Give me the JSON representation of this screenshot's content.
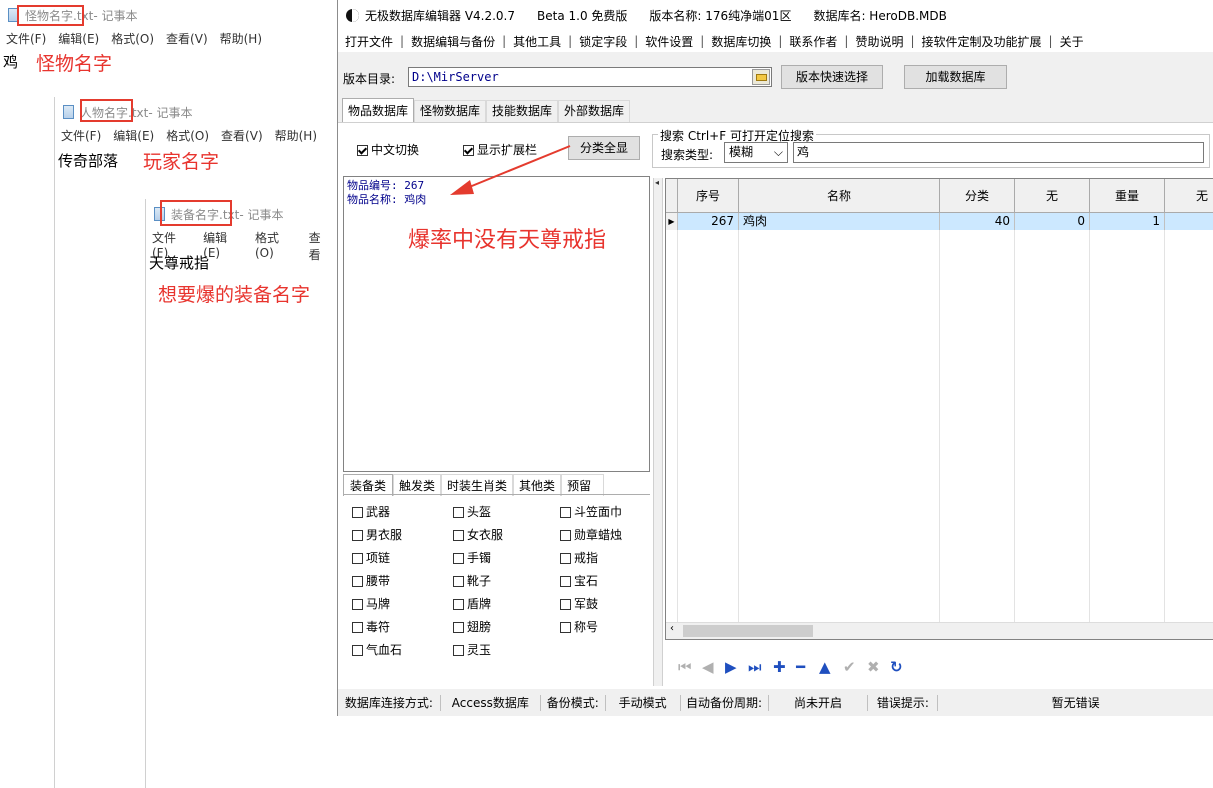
{
  "notepad1": {
    "filename": "怪物名字.txt",
    "suffix": " - 记事本",
    "menu": [
      "文件(F)",
      "编辑(E)",
      "格式(O)",
      "查看(V)",
      "帮助(H)"
    ],
    "content": "鸡",
    "annotation": "怪物名字"
  },
  "notepad2": {
    "filename": "人物名字.txt",
    "suffix": " - 记事本",
    "menu": [
      "文件(F)",
      "编辑(E)",
      "格式(O)",
      "查看(V)",
      "帮助(H)"
    ],
    "content": "传奇部落",
    "annotation": "玩家名字"
  },
  "notepad3": {
    "filename": "装备名字.txt",
    "suffix": " - 记事本",
    "menu": [
      "文件(F)",
      "编辑(E)",
      "格式(O)",
      "查看"
    ],
    "content": "天尊戒指",
    "annotation": "想要爆的装备名字"
  },
  "main": {
    "title_parts": [
      "无极数据库编辑器 V4.2.0.7",
      "Beta 1.0 免费版",
      "版本名称: 176纯净端01区",
      "数据库名: HeroDB.MDB"
    ],
    "menu": [
      "打开文件",
      "数据编辑与备份",
      "其他工具",
      "锁定字段",
      "软件设置",
      "数据库切换",
      "联系作者",
      "赞助说明",
      "接软件定制及功能扩展",
      "关于"
    ],
    "dir_label": "版本目录:",
    "dir_value": "D:\\MirServer",
    "quick_select": "版本快速选择",
    "load_db": "加载数据库",
    "tabs": [
      "物品数据库",
      "怪物数据库",
      "技能数据库",
      "外部数据库"
    ],
    "chk_chinese": "中文切换",
    "chk_extend": "显示扩展栏",
    "btn_show_all": "分类全显",
    "search_group": "搜索  Ctrl+F 可打开定位搜索",
    "search_type_label": "搜索类型:",
    "search_type_value": "模糊",
    "search_value": "鸡",
    "info_line1": "物品编号: 267",
    "info_line2": "物品名称: 鸡肉",
    "annotation_drop": "爆率中没有天尊戒指",
    "cat_tabs": [
      "装备类",
      "触发类",
      "时装生肖类",
      "其他类",
      "预留"
    ],
    "categories": [
      [
        "武器",
        "头盔",
        "斗笠面巾"
      ],
      [
        "男衣服",
        "女衣服",
        "勋章蜡烛"
      ],
      [
        "项链",
        "手镯",
        "戒指"
      ],
      [
        "腰带",
        "靴子",
        "宝石"
      ],
      [
        "马牌",
        "盾牌",
        "军鼓"
      ],
      [
        "毒符",
        "翅膀",
        "称号"
      ],
      [
        "气血石",
        "灵玉",
        ""
      ]
    ],
    "grid_headers": [
      "序号",
      "名称",
      "分类",
      "无",
      "重量",
      "无"
    ],
    "grid_row": [
      "267",
      "鸡肉",
      "40",
      "0",
      "1",
      ""
    ],
    "status": [
      "数据库连接方式:",
      "Access数据库",
      "备份模式:",
      "手动模式",
      "自动备份周期:",
      "尚未开启",
      "错误提示:",
      "暂无错误"
    ]
  }
}
